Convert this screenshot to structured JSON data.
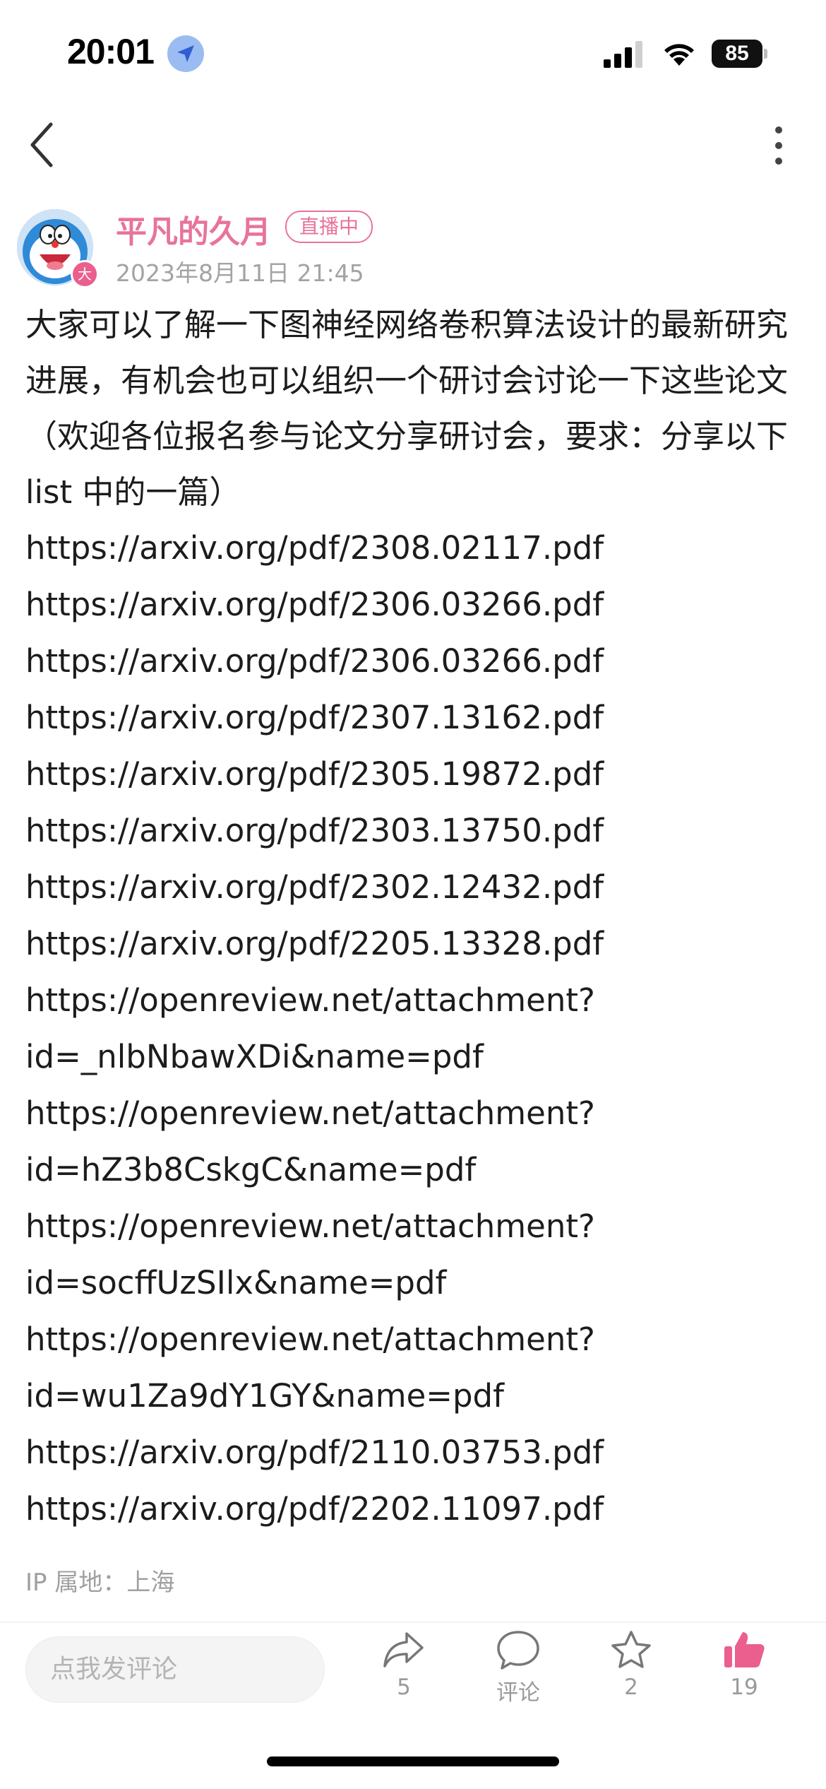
{
  "status_bar": {
    "time": "20:01",
    "battery": "85"
  },
  "post": {
    "author_name": "平凡的久月",
    "live_badge": "直播中",
    "avatar_badge": "大",
    "timestamp": "2023年8月11日 21:45",
    "text": "大家可以了解一下图神经网络卷积算法设计的最新研究进展，有机会也可以组织一个研讨会讨论一下这些论文（欢迎各位报名参与论文分享研讨会，要求：分享以下 list 中的一篇）",
    "links": [
      "https://arxiv.org/pdf/2308.02117.pdf",
      "https://arxiv.org/pdf/2306.03266.pdf",
      "https://arxiv.org/pdf/2306.03266.pdf",
      "https://arxiv.org/pdf/2307.13162.pdf",
      "https://arxiv.org/pdf/2305.19872.pdf",
      "https://arxiv.org/pdf/2303.13750.pdf",
      "https://arxiv.org/pdf/2302.12432.pdf",
      "https://arxiv.org/pdf/2205.13328.pdf",
      "https://openreview.net/attachment?\nid=_nlbNbawXDi&name=pdf",
      "https://openreview.net/attachment?\nid=hZ3b8CskgC&name=pdf",
      "https://openreview.net/attachment?\nid=socffUzSIlx&name=pdf",
      "https://openreview.net/attachment?\nid=wu1Za9dY1GY&name=pdf",
      "https://arxiv.org/pdf/2110.03753.pdf",
      "https://arxiv.org/pdf/2202.11097.pdf"
    ],
    "ip_location": "IP 属地：上海"
  },
  "bottom_bar": {
    "comment_placeholder": "点我发评论",
    "share_count": "5",
    "comment_label": "评论",
    "favorite_count": "2",
    "like_count": "19"
  },
  "colors": {
    "accent": "#e8739c",
    "like": "#ea5f8e",
    "muted": "#a3a3a3"
  },
  "icons": [
    "location-arrow-icon",
    "signal-icon",
    "wifi-icon",
    "battery-icon",
    "back-chevron-icon",
    "more-vertical-icon",
    "share-icon",
    "comment-icon",
    "star-icon",
    "thumbs-up-icon"
  ]
}
